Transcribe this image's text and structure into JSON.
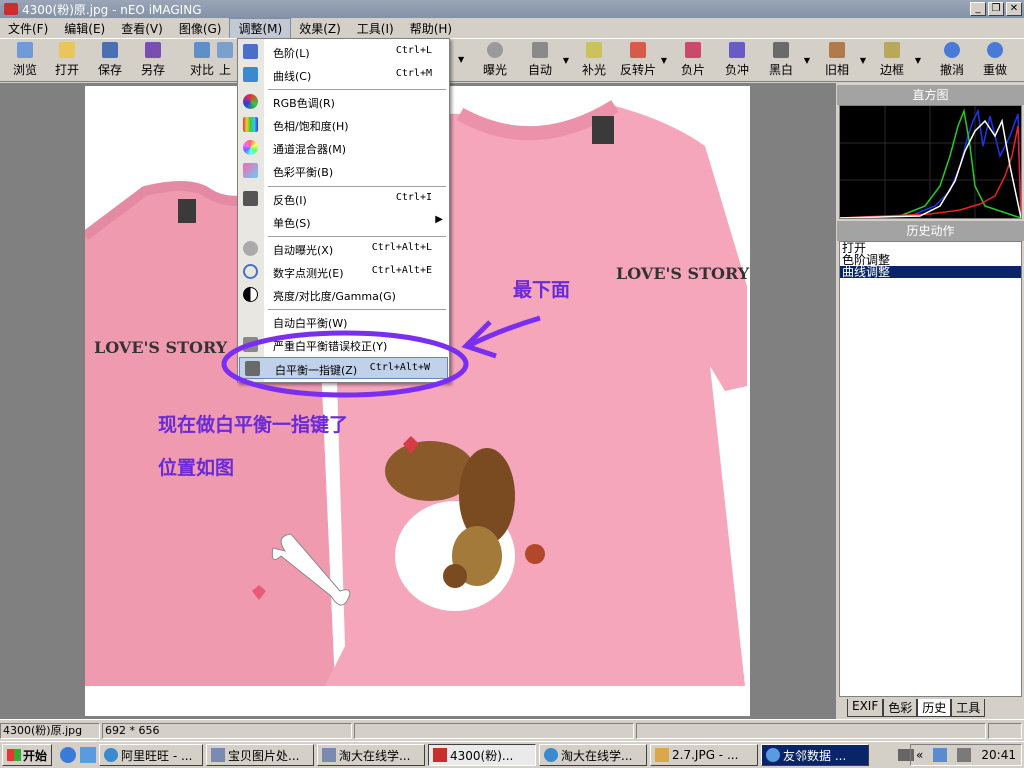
{
  "window": {
    "title": "4300(粉)原.jpg - nEO iMAGING"
  },
  "menubar": [
    "文件(F)",
    "编辑(E)",
    "查看(V)",
    "图像(G)",
    "调整(M)",
    "效果(Z)",
    "工具(I)",
    "帮助(H)"
  ],
  "toolbar": {
    "left": [
      "浏览",
      "打开",
      "保存",
      "另存",
      "对比",
      "上"
    ],
    "right": [
      "曝光",
      "自动",
      "补光",
      "反转片",
      "负片",
      "负冲",
      "黑白",
      "旧相",
      "边框",
      "撤消",
      "重做"
    ]
  },
  "menu": {
    "items": [
      {
        "label": "色阶(L)",
        "shortcut": "Ctrl+L"
      },
      {
        "label": "曲线(C)",
        "shortcut": "Ctrl+M"
      },
      {
        "label": "RGB色调(R)",
        "shortcut": ""
      },
      {
        "label": "色相/饱和度(H)",
        "shortcut": ""
      },
      {
        "label": "通道混合器(M)",
        "shortcut": ""
      },
      {
        "label": "色彩平衡(B)",
        "shortcut": ""
      },
      {
        "label": "反色(I)",
        "shortcut": "Ctrl+I"
      },
      {
        "label": "单色(S)",
        "shortcut": ""
      },
      {
        "label": "自动曝光(X)",
        "shortcut": "Ctrl+Alt+L"
      },
      {
        "label": "数字点测光(E)",
        "shortcut": "Ctrl+Alt+E"
      },
      {
        "label": "亮度/对比度/Gamma(G)",
        "shortcut": ""
      },
      {
        "label": "自动白平衡(W)",
        "shortcut": ""
      },
      {
        "label": "严重白平衡错误校正(Y)",
        "shortcut": ""
      },
      {
        "label": "白平衡一指键(Z)",
        "shortcut": "Ctrl+Alt+W"
      }
    ]
  },
  "photo": {
    "logo_left": "LOVE'S STORY",
    "logo_right": "LOVE'S STORY"
  },
  "annotations": {
    "bottom": "最下面",
    "line1": "现在做白平衡一指键了",
    "line2": "位置如图"
  },
  "panel": {
    "histogram_title": "直方图",
    "history_title": "历史动作",
    "history": [
      "打开",
      "色阶调整",
      "曲线调整"
    ],
    "tabs": [
      "EXIF",
      "色彩",
      "历史",
      "工具"
    ]
  },
  "status": {
    "file": "4300(粉)原.jpg",
    "size": "692 * 656"
  },
  "taskbar": {
    "start": "开始",
    "tasks": [
      "阿里旺旺 - ...",
      "宝贝图片处...",
      "淘大在线学...",
      "4300(粉)...",
      "淘大在线学...",
      "2.7.JPG - ...",
      "友邻数据 ..."
    ],
    "clock": "20:41"
  },
  "colors": {
    "title_bg": "#8a96ab",
    "menu_highlight": "#c2d1ea",
    "annotation": "#6a2ad8",
    "selection": "#0a246a"
  }
}
